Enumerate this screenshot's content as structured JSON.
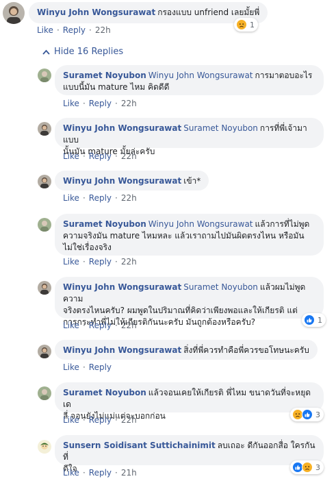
{
  "top_comment": {
    "author": "Winyu John Wongsurawat",
    "text": "กรองแบบ unfriend เลยมั้ยพี่",
    "actions": {
      "like": "Like",
      "reply": "Reply",
      "time": "22h"
    },
    "reaction_count": "1"
  },
  "hide_replies_label": "Hide 16 Replies",
  "replies": [
    {
      "author": "Suramet Noyubon",
      "mention": "Winyu John Wongsurawat",
      "text_lines": [
        "การมาตอบอะไร",
        "แบบนี้มัน mature ไหม คิดดีดี"
      ],
      "time": "22h"
    },
    {
      "author": "Winyu John Wongsurawat",
      "mention": "Suramet Noyubon",
      "text_lines": [
        "การที่พี่เจ้ามาแบบ",
        "นั้นมัน mature มั้ยล่ะครับ"
      ],
      "time": "22h"
    },
    {
      "author": "Winyu John Wongsurawat",
      "mention": "",
      "text_lines": [
        "เข้า*"
      ],
      "time": "22h"
    },
    {
      "author": "Suramet Noyubon",
      "mention": "Winyu John Wongsurawat",
      "text_lines": [
        "แล้วการที่ไม่พูด",
        "ความจริงมัน mature ไหมหละ แล้วเราถามไปมันผิดตรงไหน หรือมัน",
        "ไม่ใช่เรื่องจริง"
      ],
      "time": "22h"
    },
    {
      "author": "Winyu John Wongsurawat",
      "mention": "Suramet Noyubon",
      "text_lines": [
        "แล้วผมไม่พูดความ",
        "จริงตรงไหนครับ? ผมพูดในปริมาณที่คิดว่าเพียงพอและให้เกียรติ แต่",
        "การกระทำพี่ไม่ให้เกียรติกันนะครับ มันถูกต้องหรือครับ?"
      ],
      "time": "22h",
      "reaction_count": "1"
    },
    {
      "author": "Winyu John Wongsurawat",
      "mention": "",
      "text_lines": [
        "สิ่งที่พี่ควรทำคือพี่ควรขอโทษนะครับ"
      ],
      "time": ""
    },
    {
      "author": "Suramet Noyubon",
      "mention": "",
      "text_lines": [
        "แล้วจอนเคยให้เกียรติ พี่ไหม ขนาดวันที่จะหยุดเด",
        "ลี่ จอนยังไม่แม่แต่จะบอกก่อน"
      ],
      "time": "22h",
      "reaction_count": "3"
    },
    {
      "author": "Sunsern Soidisant Suttichainimit",
      "mention": "",
      "text_lines": [
        "ลบเถอะ ดีกันออกสื่อ ใครกันที่",
        "ดีใจ"
      ],
      "time": "21h",
      "reaction_count": "3"
    }
  ],
  "actions": {
    "like": "Like",
    "reply": "Reply"
  },
  "colors": {
    "link": "#385898",
    "bubble": "#f2f3f5",
    "like_blue": "#1877f2",
    "sad_yellow": "#f7b125"
  },
  "icons": [
    "chevron-up-icon",
    "like-reaction-icon",
    "sad-reaction-icon"
  ]
}
